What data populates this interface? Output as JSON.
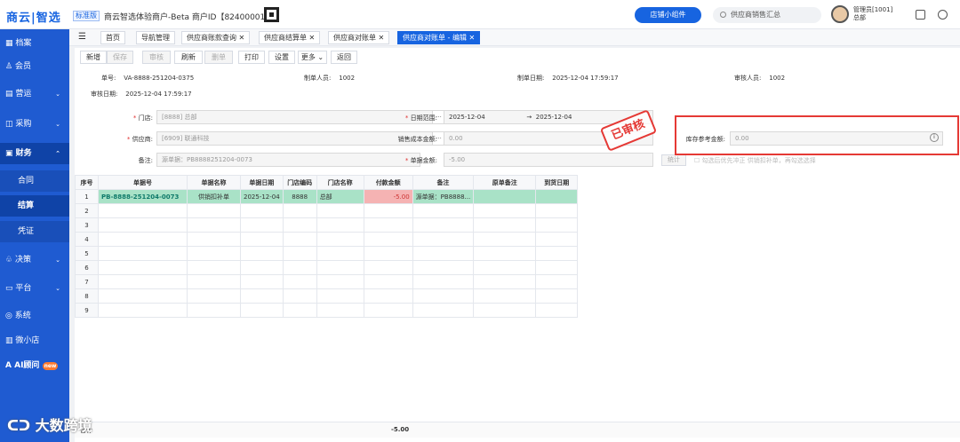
{
  "header": {
    "logo": "商云|智选",
    "edition": "标准版",
    "merchant": "商云智选体验商户-Beta  商户ID【82400001】",
    "widget_button": "店铺小组件",
    "search_placeholder": "供应商销售汇总",
    "user_name": "管理员[1001]",
    "user_store": "总部"
  },
  "sidebar": {
    "items": [
      {
        "label": "档案"
      },
      {
        "label": "会员"
      },
      {
        "label": "营运"
      },
      {
        "label": "采购"
      },
      {
        "label": "财务"
      },
      {
        "label": "合同"
      },
      {
        "label": "结算"
      },
      {
        "label": "凭证"
      },
      {
        "label": "决策"
      },
      {
        "label": "平台"
      },
      {
        "label": "系统"
      },
      {
        "label": "微小店"
      },
      {
        "label": "AI顾问"
      }
    ],
    "ai_badge": "new"
  },
  "tabs": [
    "首页",
    "导航管理",
    "供应商账款查询",
    "供应商结算单",
    "供应商对账单",
    "供应商对账单 - 编辑"
  ],
  "toolbar": [
    "新增",
    "保存",
    "审核",
    "刷新",
    "删单",
    "打印",
    "设置",
    "更多",
    "返回"
  ],
  "doc": {
    "no_label": "单号:",
    "no": "VA-8888-251204-0375",
    "creator_label": "制单人员:",
    "creator": "1002",
    "created_label": "制单日期:",
    "created": "2025-12-04 17:59:17",
    "reviewer_label": "审核人员:",
    "reviewer": "1002",
    "reviewed_label": "审核日期:",
    "reviewed": "2025-12-04 17:59:17"
  },
  "form": {
    "store_label": "门店:",
    "store_value": "[8888]  总部",
    "supplier_label": "供应商:",
    "supplier_value": "[6909]  联通科技",
    "note_label": "备注:",
    "note_value": "源单据：PB8888251204-0073",
    "date_label": "日期范围:",
    "date_start": "2025-12-04",
    "date_end": "2025-12-04",
    "cost_label": "销售成本金额:",
    "cost_value": "0.00",
    "amount_label": "单据金额:",
    "amount_value": "-5.00",
    "stock_label": "库存参考金额:",
    "stock_value": "0.00",
    "stat_button": "统计",
    "check_label": "勾选后优先冲正 供销扣补单，再勾选选择",
    "stamp": "已审核"
  },
  "table": {
    "headers": [
      "序号",
      "单据号",
      "单据名称",
      "单据日期",
      "门店编码",
      "门店名称",
      "付款金额",
      "备注",
      "原单备注",
      "到货日期"
    ],
    "rows": [
      [
        "1",
        "PB-8888-251204-0073",
        "供销扣补单",
        "2025-12-04",
        "8888",
        "总部",
        "-5.00",
        "源单据：PB8888...",
        "",
        ""
      ],
      [
        "2",
        "",
        "",
        "",
        "",
        "",
        "",
        "",
        "",
        ""
      ],
      [
        "3",
        "",
        "",
        "",
        "",
        "",
        "",
        "",
        "",
        ""
      ],
      [
        "4",
        "",
        "",
        "",
        "",
        "",
        "",
        "",
        "",
        ""
      ],
      [
        "5",
        "",
        "",
        "",
        "",
        "",
        "",
        "",
        "",
        ""
      ],
      [
        "6",
        "",
        "",
        "",
        "",
        "",
        "",
        "",
        "",
        ""
      ],
      [
        "7",
        "",
        "",
        "",
        "",
        "",
        "",
        "",
        "",
        ""
      ],
      [
        "8",
        "",
        "",
        "",
        "",
        "",
        "",
        "",
        "",
        ""
      ],
      [
        "9",
        "",
        "",
        "",
        "",
        "",
        "",
        "",
        "",
        ""
      ]
    ],
    "total_label": "合计",
    "total": "-5.00"
  },
  "watermark": "大数跨境",
  "colors": {
    "brand": "#1764e0",
    "highlight_row": "#a9e2c7",
    "stamp": "#e53935"
  }
}
